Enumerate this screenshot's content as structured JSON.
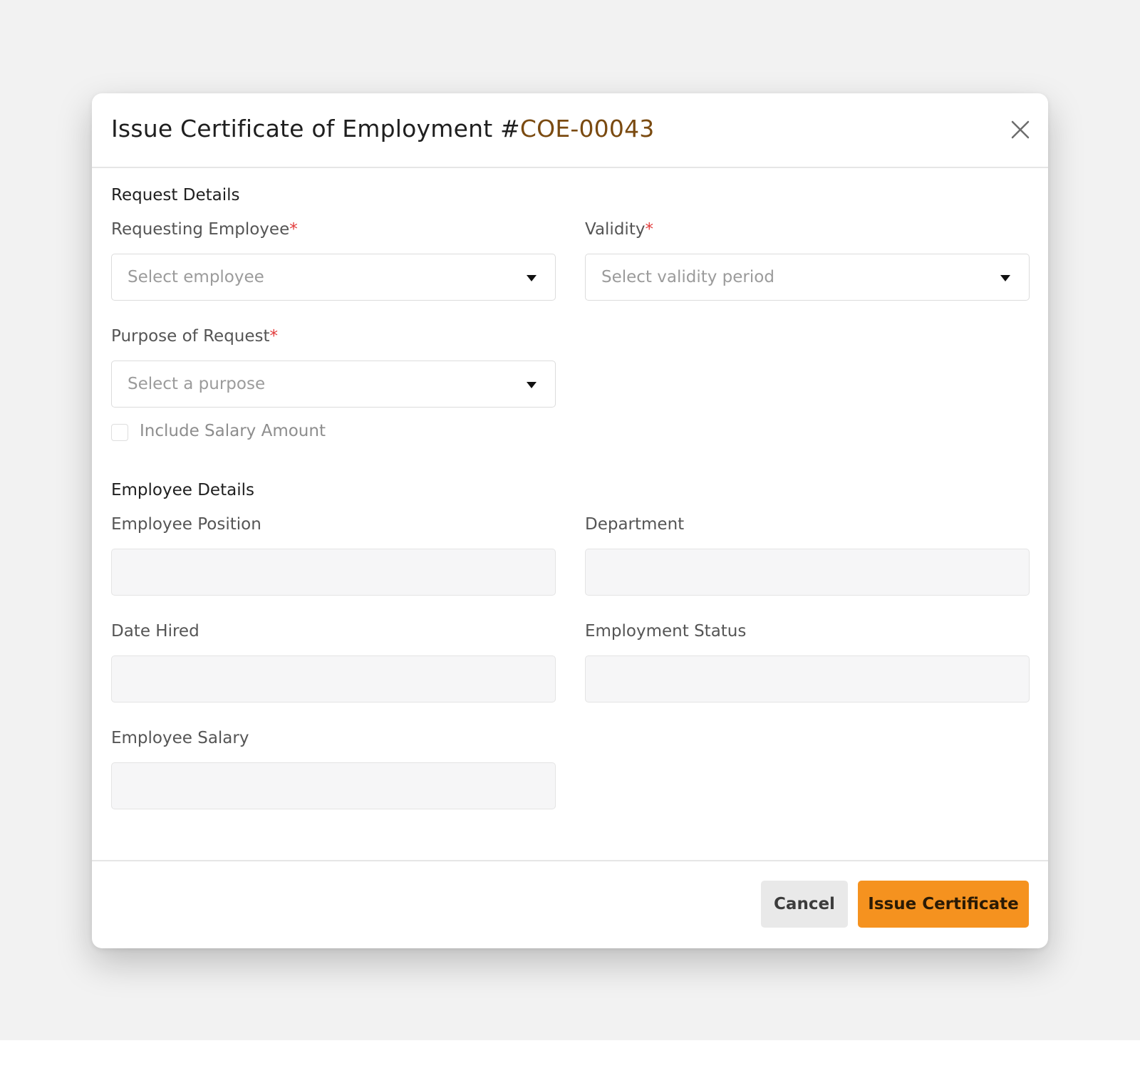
{
  "modal": {
    "title_prefix": "Issue Certificate of Employment #",
    "certificate_code": "COE-00043",
    "close_icon": "close-icon"
  },
  "request_details": {
    "section_title": "Request Details",
    "requesting_employee": {
      "label": "Requesting Employee",
      "required_mark": "*",
      "placeholder": "Select employee"
    },
    "validity": {
      "label": "Validity",
      "required_mark": "*",
      "placeholder": "Select validity period"
    },
    "purpose": {
      "label": "Purpose of Request",
      "required_mark": "*",
      "placeholder": "Select a purpose"
    },
    "include_salary": {
      "label": "Include Salary Amount",
      "checked": false
    }
  },
  "employee_details": {
    "section_title": "Employee Details",
    "position": {
      "label": "Employee Position",
      "value": ""
    },
    "department": {
      "label": "Department",
      "value": ""
    },
    "date_hired": {
      "label": "Date Hired",
      "value": ""
    },
    "employment_status": {
      "label": "Employment Status",
      "value": ""
    },
    "salary": {
      "label": "Employee Salary",
      "value": ""
    }
  },
  "footer": {
    "cancel_label": "Cancel",
    "issue_label": "Issue Certificate"
  },
  "colors": {
    "accent": "#f5921f",
    "code": "#7a4a10",
    "required": "#e23b3b"
  }
}
